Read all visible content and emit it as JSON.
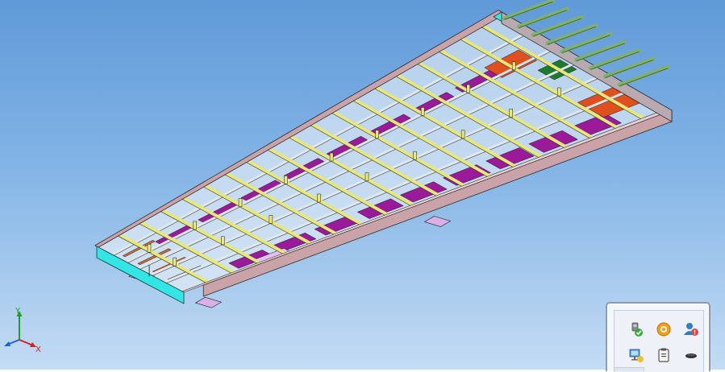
{
  "viewport": {
    "background_top": "#5f9ad8",
    "background_bottom": "#c4dcf4"
  },
  "model": {
    "colors": {
      "side_rail": "#c9a3a8",
      "end_channel": "#33e6e6",
      "cross_beam": "#e8e87a",
      "longitudinal": "#dfe8ee",
      "purple_plate": "#9a1a9a",
      "orange_plate": "#e0501e",
      "green_plate": "#1e7a2e",
      "floor_edge": "#b05cc8",
      "brown_bar": "#c96b3c",
      "pipe": "#7fb070",
      "outline": "#1a1a1a"
    }
  },
  "triad": {
    "x_label": "X",
    "y_label": "Y",
    "icon": "coordinate-axes-icon",
    "x_color": "#d02020",
    "y_color": "#20a020",
    "z_color": "#2060d0"
  },
  "tray": {
    "icons": [
      {
        "name": "usb-safely-remove-icon",
        "color": "#3aa83a"
      },
      {
        "name": "orange-ring-app-icon",
        "color": "#f0a020"
      },
      {
        "name": "user-warning-icon",
        "color": "#2a7fd0"
      },
      {
        "name": "network-monitor-icon",
        "color": "#4a8ac8"
      },
      {
        "name": "clipboard-device-icon",
        "color": "#555555"
      },
      {
        "name": "pen-tablet-icon",
        "color": "#333333"
      }
    ]
  }
}
